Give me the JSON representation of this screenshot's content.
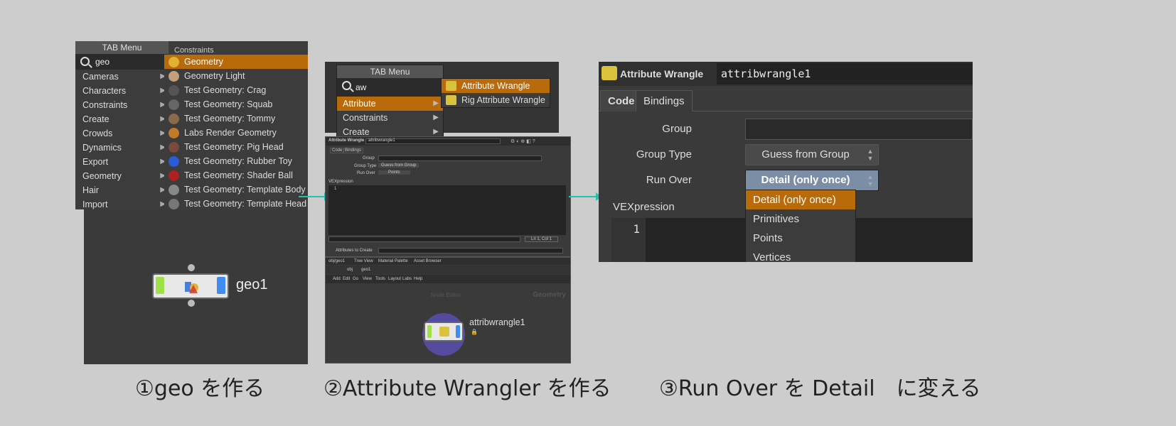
{
  "panel1": {
    "menu_title": "TAB Menu",
    "search_value": "geo",
    "right_header": "Constraints",
    "categories": [
      "Cameras",
      "Characters",
      "Constraints",
      "Create",
      "Crowds",
      "Dynamics",
      "Export",
      "Geometry",
      "Hair",
      "Import"
    ],
    "submenu": [
      {
        "label": "Geometry",
        "active": true
      },
      {
        "label": "Geometry Light"
      },
      {
        "label": "Test Geometry: Crag"
      },
      {
        "label": "Test Geometry: Squab"
      },
      {
        "label": "Test Geometry: Tommy"
      },
      {
        "label": "Labs Render Geometry"
      },
      {
        "label": "Test Geometry: Pig Head"
      },
      {
        "label": "Test Geometry: Rubber Toy"
      },
      {
        "label": "Test Geometry: Shader Ball"
      },
      {
        "label": "Test Geometry: Template Body"
      },
      {
        "label": "Test Geometry: Template Head"
      }
    ],
    "node_label": "geo1",
    "caption": "①geo を作る"
  },
  "panel2": {
    "menu_title": "TAB Menu",
    "search_value": "aw",
    "items": [
      {
        "label": "Attribute",
        "active": true
      },
      {
        "label": "Constraints"
      },
      {
        "label": "Create"
      }
    ],
    "submenu": [
      {
        "label": "Attribute Wrangle",
        "active": true
      },
      {
        "label": "Rig Attribute Wrangle"
      }
    ],
    "param_type": "Attribute Wrangle",
    "param_name": "attribwrangle1",
    "tabs": [
      "Code",
      "Bindings"
    ],
    "group_label": "Group",
    "group_type_label": "Group Type",
    "group_type_value": "Guess from Group",
    "run_over_label": "Run Over",
    "run_over_value": "Points",
    "vex_label": "VEXpression",
    "line_number": "1",
    "status": "Ln 1, Col 1",
    "attrs_label": "Attributes to Create",
    "net_tabs": [
      "obj/geo1",
      "Tree View",
      "Material Palette",
      "Asset Browser"
    ],
    "path": [
      "obj",
      "geo1"
    ],
    "menus": [
      "Add",
      "Edit",
      "Go",
      "View",
      "Tools",
      "Layout",
      "Labs",
      "Help"
    ],
    "watermark": "Geometry",
    "net_title": "Node Editor",
    "node_label": "attribwrangle1",
    "caption": "②Attribute Wrangler を作る"
  },
  "panel3": {
    "type": "Attribute Wrangle",
    "name": "attribwrangle1",
    "tabs": [
      "Code",
      "Bindings"
    ],
    "group_label": "Group",
    "group_type_label": "Group Type",
    "group_type_value": "Guess from Group",
    "run_over_label": "Run Over",
    "run_over_value": "Detail (only once)",
    "dropdown": [
      {
        "label": "Detail (only once)",
        "active": true
      },
      {
        "label": "Primitives"
      },
      {
        "label": "Points"
      },
      {
        "label": "Vertices"
      }
    ],
    "vex_label": "VEXpression",
    "line_number": "1",
    "caption": "③Run Over を Detail　に変える"
  },
  "colors": {
    "accent": "#b96b0b",
    "connector": "#25c1ad",
    "panel_bg": "#3a3a3a",
    "page_bg": "#cdcdcd"
  }
}
